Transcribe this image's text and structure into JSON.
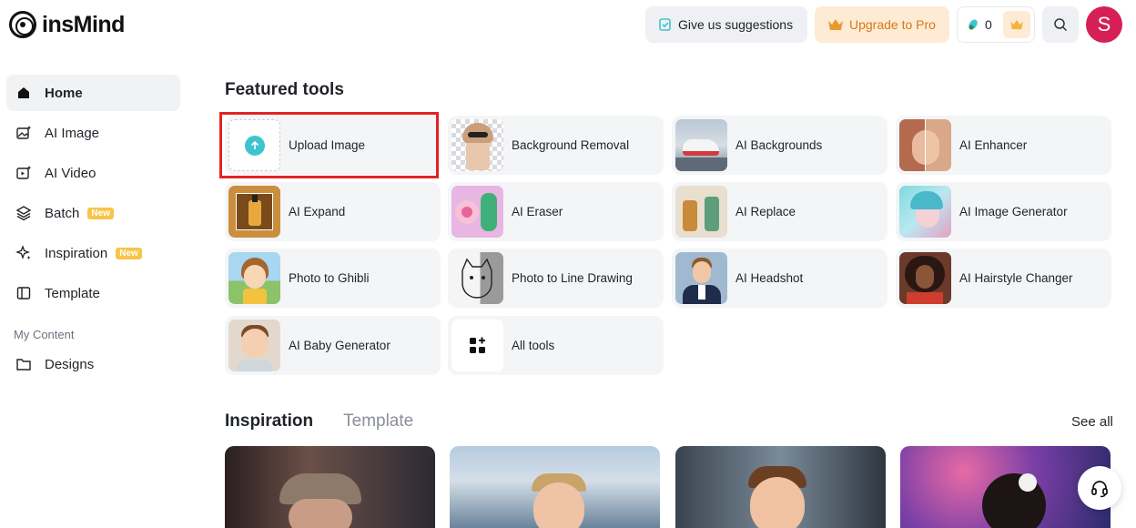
{
  "app": {
    "logo_text": "insMind"
  },
  "header": {
    "suggestions_label": "Give us suggestions",
    "upgrade_label": "Upgrade to Pro",
    "credits_count": "0",
    "avatar_letter": "S",
    "accent_color": "#d61f55"
  },
  "sidebar": {
    "items": [
      {
        "label": "Home",
        "icon": "home-icon"
      },
      {
        "label": "AI Image",
        "icon": "ai-image-icon"
      },
      {
        "label": "AI Video",
        "icon": "ai-video-icon"
      },
      {
        "label": "Batch",
        "icon": "batch-icon",
        "badge": "New"
      },
      {
        "label": "Inspiration",
        "icon": "inspiration-icon",
        "badge": "New"
      },
      {
        "label": "Template",
        "icon": "template-icon"
      }
    ],
    "section_label": "My Content",
    "content_items": [
      {
        "label": "Designs",
        "icon": "folder-icon"
      }
    ]
  },
  "main": {
    "title": "Featured tools",
    "tools": [
      {
        "label": "Upload Image"
      },
      {
        "label": "Background Removal"
      },
      {
        "label": "AI Backgrounds"
      },
      {
        "label": "AI Enhancer"
      },
      {
        "label": "AI Expand"
      },
      {
        "label": "AI Eraser"
      },
      {
        "label": "AI Replace"
      },
      {
        "label": "AI Image Generator"
      },
      {
        "label": "Photo to Ghibli"
      },
      {
        "label": "Photo to Line Drawing"
      },
      {
        "label": "AI Headshot"
      },
      {
        "label": "AI Hairstyle Changer"
      },
      {
        "label": "AI Baby Generator"
      },
      {
        "label": "All tools"
      }
    ],
    "tabs": [
      {
        "label": "Inspiration"
      },
      {
        "label": "Template"
      }
    ],
    "see_all": "See all"
  }
}
